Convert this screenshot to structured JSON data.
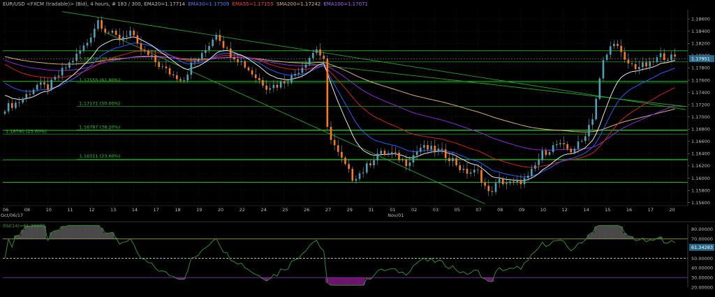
{
  "header": {
    "symbol": "EUR/USD <FXCM (tradable)> (Bid), 4 hours, # 183 / 300, EMA20=1.17714",
    "ema30": "EMA30=1.17509",
    "ema55": "EMA55=1.17155",
    "sma200": "SMA200=1.17242",
    "ema100": "EMA100=1.17071"
  },
  "colors": {
    "bull": "#4aa3b8",
    "bear": "#ff7a1a",
    "ema20": "#e8e8e8",
    "ema30": "#2a5cff",
    "ema55": "#d02020",
    "sma200": "#d8b07a",
    "ema100": "#8a2ccf",
    "fib": "#30c030",
    "trend": "#2fa02f",
    "rsi": "#2f8a2f"
  },
  "chart_data": {
    "type": "candlestick",
    "ylim": [
      1.1555,
      1.1875
    ],
    "y_ticks": [
      "1.18600",
      "1.18400",
      "1.18200",
      "1.18000",
      "1.17800",
      "1.17600",
      "1.17400",
      "1.17200",
      "1.17000",
      "1.16800",
      "1.16600",
      "1.16400",
      "1.16200",
      "1.16000",
      "1.15800",
      "1.15600"
    ],
    "current_price": "1.17951",
    "x_ticks": [
      {
        "i": 0,
        "label": "06"
      },
      {
        "i": 6,
        "label": "08"
      },
      {
        "i": 12,
        "label": "10"
      },
      {
        "i": 18,
        "label": "11"
      },
      {
        "i": 24,
        "label": "12"
      },
      {
        "i": 30,
        "label": "13"
      },
      {
        "i": 36,
        "label": "14"
      },
      {
        "i": 42,
        "label": "17"
      },
      {
        "i": 48,
        "label": "18"
      },
      {
        "i": 54,
        "label": "19"
      },
      {
        "i": 60,
        "label": "20"
      },
      {
        "i": 66,
        "label": "22"
      },
      {
        "i": 72,
        "label": "24"
      },
      {
        "i": 78,
        "label": "25"
      },
      {
        "i": 84,
        "label": "26"
      },
      {
        "i": 90,
        "label": "27"
      },
      {
        "i": 96,
        "label": "29"
      },
      {
        "i": 102,
        "label": "31"
      },
      {
        "i": 108,
        "label": "01"
      },
      {
        "i": 114,
        "label": "02"
      },
      {
        "i": 120,
        "label": "03"
      },
      {
        "i": 126,
        "label": "05"
      },
      {
        "i": 132,
        "label": "07"
      },
      {
        "i": 138,
        "label": "08"
      },
      {
        "i": 144,
        "label": "09"
      },
      {
        "i": 150,
        "label": "10"
      },
      {
        "i": 156,
        "label": "12"
      },
      {
        "i": 162,
        "label": "14"
      },
      {
        "i": 168,
        "label": "15"
      },
      {
        "i": 174,
        "label": "16"
      },
      {
        "i": 180,
        "label": "17"
      },
      {
        "i": 186,
        "label": "20"
      }
    ],
    "x_sub_labels": [
      {
        "i": 0,
        "label": "Oct/06/17"
      },
      {
        "i": 108,
        "label": "Nov/01"
      }
    ],
    "fib_levels": [
      {
        "value": 1.17899,
        "label": "1.18159 (78.60%)"
      },
      {
        "value": 1.17555,
        "label": "1.17555 (61.80%)"
      },
      {
        "value": 1.17171,
        "label": "1.17171 (50.00%)"
      },
      {
        "value": 1.16787,
        "label": "1.16787 (38.20%)"
      },
      {
        "value": 1.16311,
        "label": "1.16311 (23.60%)"
      },
      {
        "value": 1.1672,
        "label": "1.16790 (23.60%)"
      }
    ],
    "horizontal_lines": [
      1.1808,
      1.1758,
      1.1678,
      1.163,
      1.1593
    ],
    "trendlines": [
      {
        "i0": 16,
        "v0": 1.1872,
        "i1": 190,
        "v1": 1.1712
      },
      {
        "i0": 28,
        "v0": 1.1838,
        "i1": 134,
        "v1": 1.1558
      },
      {
        "i0": 80,
        "v0": 1.179,
        "i1": 190,
        "v1": 1.1717
      }
    ],
    "waypoints": [
      [
        0,
        1.1715
      ],
      [
        4,
        1.1725
      ],
      [
        9,
        1.1752
      ],
      [
        12,
        1.1748
      ],
      [
        16,
        1.1775
      ],
      [
        20,
        1.18
      ],
      [
        23,
        1.1822
      ],
      [
        26,
        1.1858
      ],
      [
        28,
        1.1842
      ],
      [
        30,
        1.1835
      ],
      [
        32,
        1.1828
      ],
      [
        35,
        1.184
      ],
      [
        37,
        1.1815
      ],
      [
        40,
        1.18
      ],
      [
        44,
        1.178
      ],
      [
        47,
        1.1768
      ],
      [
        50,
        1.1762
      ],
      [
        52,
        1.1785
      ],
      [
        55,
        1.18
      ],
      [
        59,
        1.1838
      ],
      [
        62,
        1.1808
      ],
      [
        66,
        1.179
      ],
      [
        70,
        1.1765
      ],
      [
        73,
        1.175
      ],
      [
        76,
        1.1752
      ],
      [
        80,
        1.1765
      ],
      [
        83,
        1.1783
      ],
      [
        87,
        1.1812
      ],
      [
        89,
        1.179
      ],
      [
        90,
        1.168
      ],
      [
        93,
        1.164
      ],
      [
        97,
        1.16
      ],
      [
        100,
        1.1612
      ],
      [
        104,
        1.164
      ],
      [
        108,
        1.164
      ],
      [
        112,
        1.1625
      ],
      [
        116,
        1.165
      ],
      [
        121,
        1.1645
      ],
      [
        125,
        1.163
      ],
      [
        128,
        1.161
      ],
      [
        132,
        1.161
      ],
      [
        135,
        1.1575
      ],
      [
        138,
        1.1595
      ],
      [
        142,
        1.159
      ],
      [
        146,
        1.16
      ],
      [
        150,
        1.164
      ],
      [
        154,
        1.1655
      ],
      [
        158,
        1.1645
      ],
      [
        161,
        1.166
      ],
      [
        164,
        1.17
      ],
      [
        167,
        1.179
      ],
      [
        170,
        1.1825
      ],
      [
        173,
        1.179
      ],
      [
        176,
        1.1782
      ],
      [
        180,
        1.1785
      ],
      [
        183,
        1.18
      ],
      [
        187,
        1.1796
      ]
    ],
    "ma_offsets": {
      "ema20": 20,
      "ema30": 30,
      "ema55": 55,
      "ema100": 100,
      "sma200": 200
    },
    "rsi": {
      "label": "RSI(14)=61.34283",
      "current": "61.34283",
      "ylim": [
        20,
        85
      ],
      "y_ticks": [
        "80.00000",
        "70.00000",
        "60.00000",
        "50.00000",
        "40.00000",
        "30.00000",
        "20.00000"
      ],
      "overbought": 70,
      "oversold": 30,
      "mid": 50
    }
  }
}
